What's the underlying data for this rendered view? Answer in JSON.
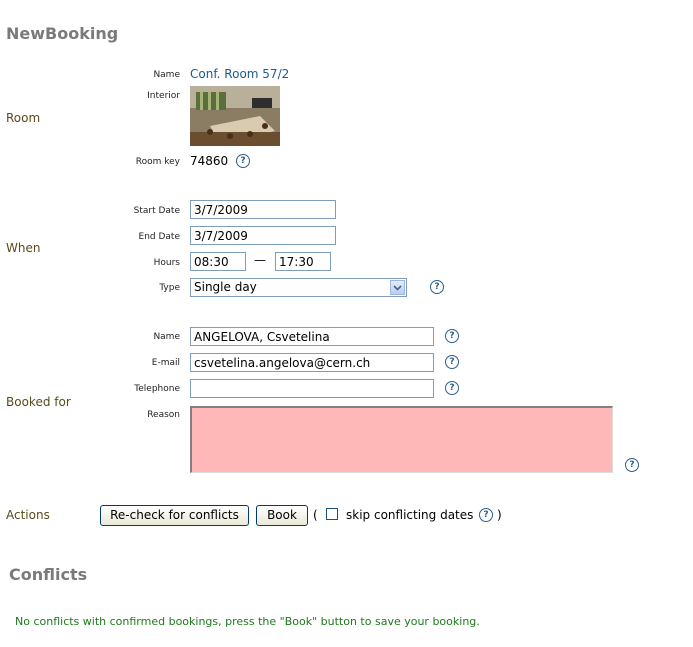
{
  "title": "NewBooking",
  "room": {
    "section_label": "Room",
    "name_label": "Name",
    "name_value": "Conf. Room 57/2",
    "interior_label": "Interior",
    "key_label": "Room key",
    "key_value": "74860"
  },
  "when": {
    "section_label": "When",
    "start_label": "Start Date",
    "start_value": "3/7/2009",
    "end_label": "End Date",
    "end_value": "3/7/2009",
    "hours_label": "Hours",
    "hours_from": "08:30",
    "hours_sep": "—",
    "hours_to": "17:30",
    "type_label": "Type",
    "type_value": "Single day"
  },
  "booked_for": {
    "section_label": "Booked for",
    "name_label": "Name",
    "name_value": "ANGELOVA, Csvetelina",
    "email_label": "E-mail",
    "email_value": "csvetelina.angelova@cern.ch",
    "phone_label": "Telephone",
    "phone_value": "",
    "reason_label": "Reason",
    "reason_value": ""
  },
  "actions": {
    "section_label": "Actions",
    "recheck_label": "Re-check for conflicts",
    "book_label": "Book",
    "paren_open": "(",
    "skip_label": "skip conflicting dates",
    "paren_close": ")"
  },
  "conflicts": {
    "title": "Conflicts",
    "message": "No conflicts with confirmed bookings, press the \"Book\" button to save your booking."
  },
  "help_glyph": "?",
  "icons": [
    "help-icon",
    "chevron-down-icon",
    "checkbox-icon"
  ],
  "colors": {
    "section_label": "#5b4a1b",
    "link": "#1a5c8e",
    "success_message": "#1e7a1e",
    "reason_bg": "#ffb8b8"
  }
}
